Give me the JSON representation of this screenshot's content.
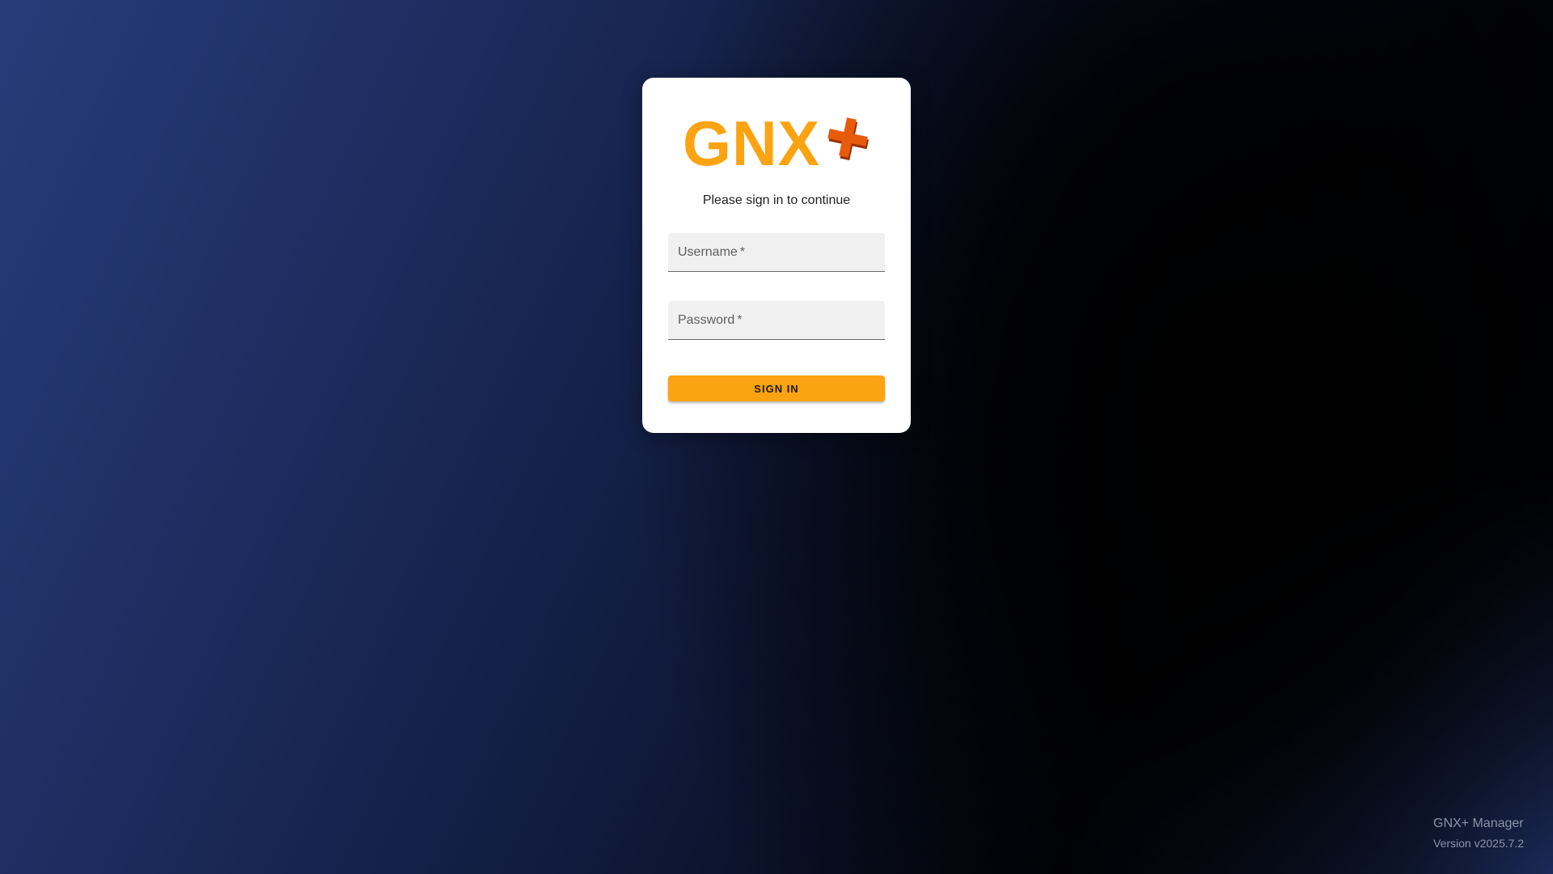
{
  "login": {
    "subtitle": "Please sign in to continue",
    "username": {
      "label": "Username",
      "required_mark": "*",
      "value": ""
    },
    "password": {
      "label": "Password",
      "required_mark": "*",
      "value": ""
    },
    "sign_in_label": "SIGN IN"
  },
  "logo": {
    "icon": "gnx-plus-logo",
    "text": "GNX",
    "color_primary": "#FCA311",
    "color_plus": "#E85A0C"
  },
  "footer": {
    "app_name": "GNX+ Manager",
    "version": "Version v2025.7.2"
  },
  "colors": {
    "accent": "#FCA311",
    "card_background": "#FFFFFF",
    "field_background": "#F0F0F0"
  }
}
